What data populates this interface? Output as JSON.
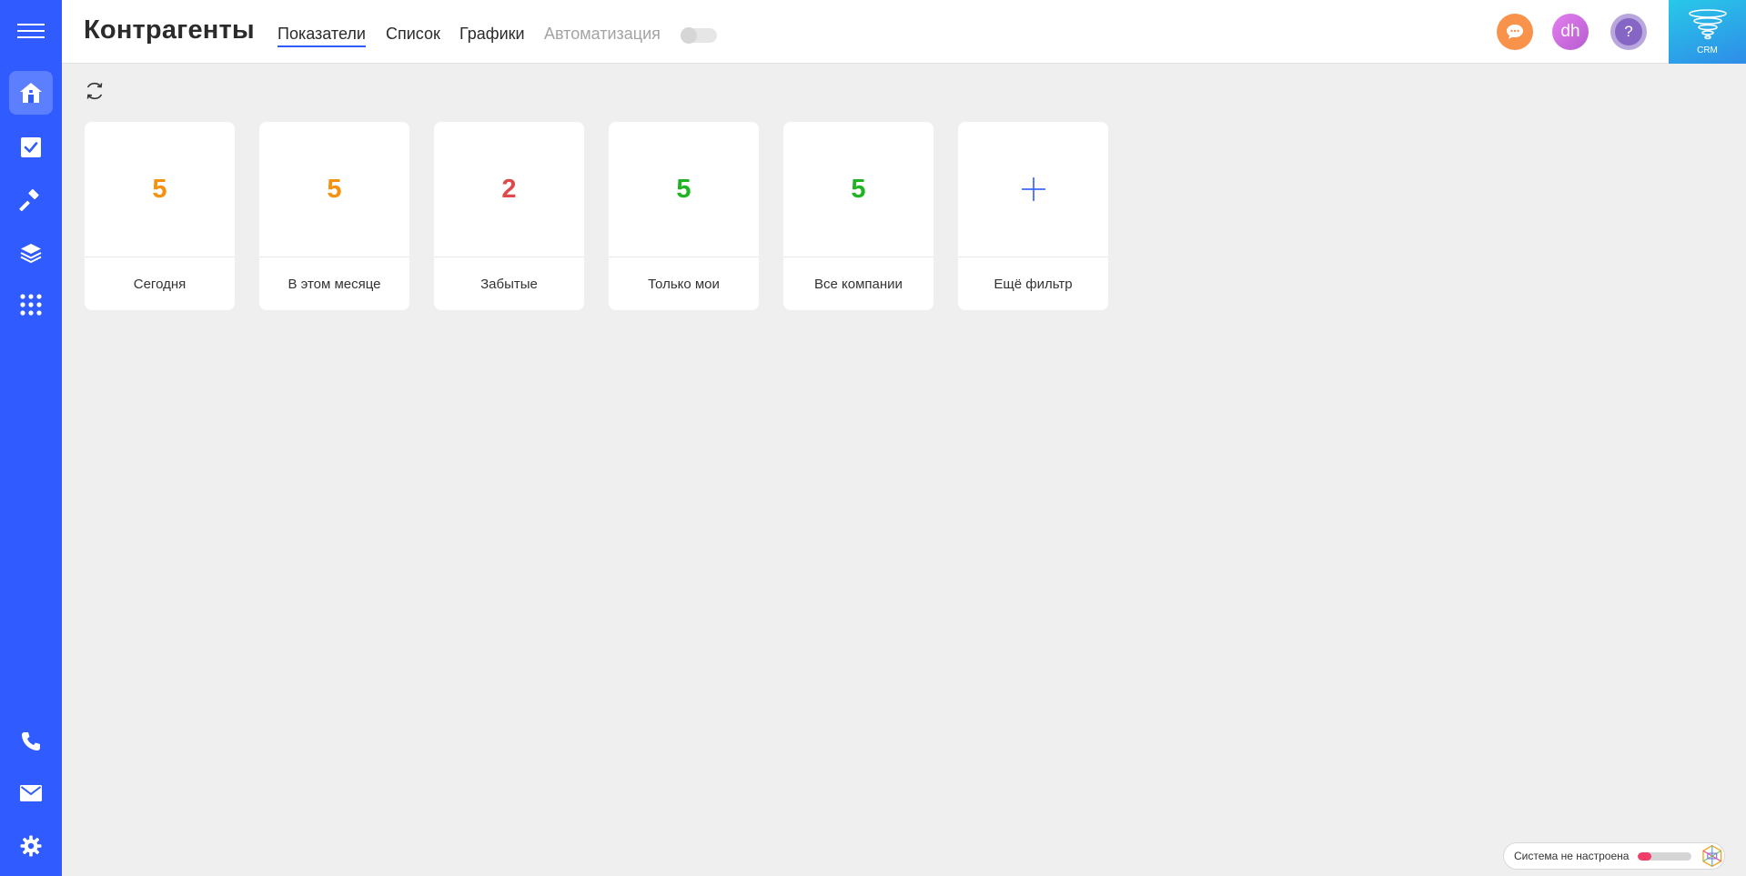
{
  "header": {
    "title": "Контрагенты",
    "tabs": [
      {
        "label": "Показатели",
        "active": true
      },
      {
        "label": "Список"
      },
      {
        "label": "Графики"
      },
      {
        "label": "Автоматизация",
        "muted": true
      }
    ],
    "automation_toggle_on": false,
    "avatar_initials": "dh",
    "help_symbol": "?",
    "logo_text": "CRM"
  },
  "sidebar": {
    "top_icons": [
      "menu-icon",
      "home-icon",
      "tasks-check-icon",
      "hammer-icon",
      "layers-icon",
      "apps-grid-icon"
    ],
    "bottom_icons": [
      "phone-icon",
      "mail-icon",
      "settings-gear-icon"
    ],
    "active": "home-icon"
  },
  "cards": [
    {
      "value": "5",
      "label": "Сегодня",
      "color": "#f5920f"
    },
    {
      "value": "5",
      "label": "В этом месяце",
      "color": "#f5920f"
    },
    {
      "value": "2",
      "label": "Забытые",
      "color": "#e0494b"
    },
    {
      "value": "5",
      "label": "Только мои",
      "color": "#1fb421"
    },
    {
      "value": "5",
      "label": "Все компании",
      "color": "#1fb421"
    },
    {
      "value": "+",
      "label": "Ещё фильтр",
      "color": "#2f5bff",
      "is_add": true
    }
  ],
  "status": {
    "text": "Система не настроена",
    "progress": 0.25,
    "progress_color": "#f03e6a"
  },
  "colors": {
    "accent": "#2f5bff",
    "background": "#efefef"
  }
}
